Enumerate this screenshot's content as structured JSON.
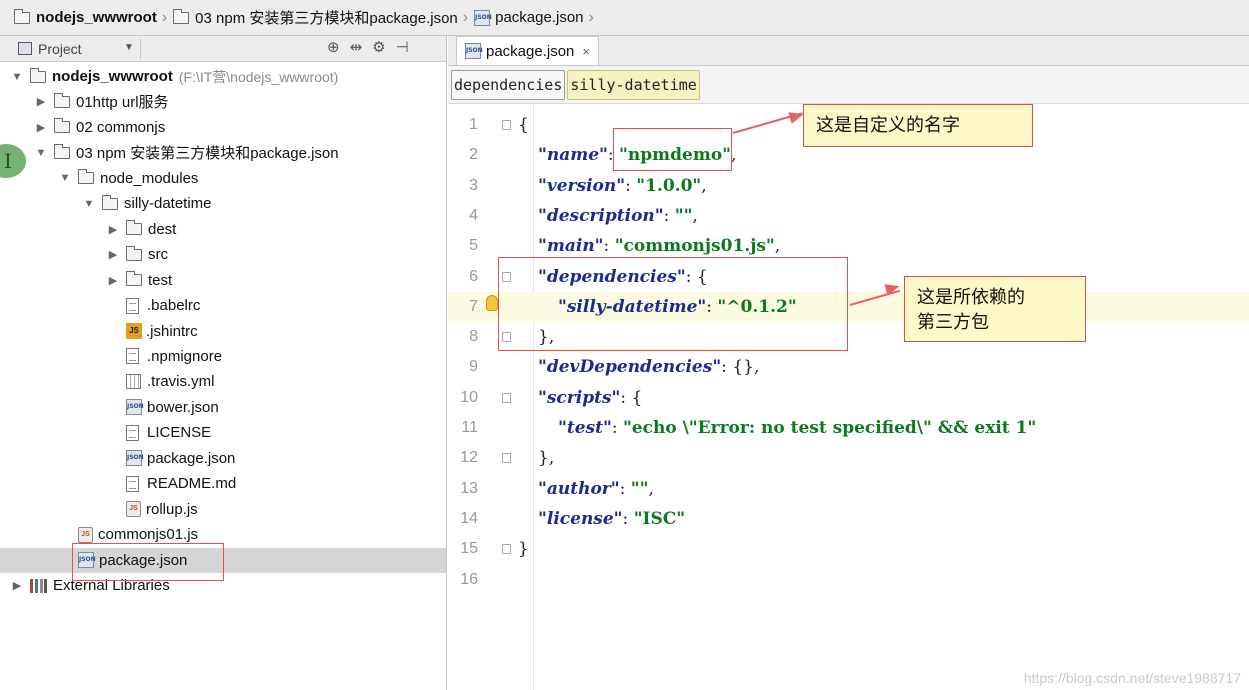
{
  "breadcrumb": [
    {
      "label": "nodejs_wwwroot",
      "icon": "folder-icon",
      "bold": true
    },
    {
      "label": "03 npm 安装第三方模块和package.json",
      "icon": "folder-icon",
      "bold": false
    },
    {
      "label": "package.json",
      "icon": "json-file-icon",
      "bold": false
    }
  ],
  "project_panel": {
    "title": "Project",
    "toolbar_icons": [
      "sync-icon",
      "collapse-icon",
      "gear-icon",
      "hide-panel-icon"
    ],
    "tree": [
      {
        "label": "nodejs_wwwroot",
        "meta": "(F:\\IT营\\nodejs_wwwroot)",
        "type": "folder",
        "level": 0,
        "expanded": true,
        "bold": true
      },
      {
        "label": "01http url服务",
        "type": "folder",
        "level": 1,
        "expanded": false
      },
      {
        "label": "02 commonjs",
        "type": "folder",
        "level": 1,
        "expanded": false
      },
      {
        "label": "03 npm 安装第三方模块和package.json",
        "type": "folder",
        "level": 1,
        "expanded": true
      },
      {
        "label": "node_modules",
        "type": "folder",
        "level": 2,
        "expanded": true
      },
      {
        "label": "silly-datetime",
        "type": "folder",
        "level": 3,
        "expanded": true
      },
      {
        "label": "dest",
        "type": "folder",
        "level": 4,
        "expanded": false
      },
      {
        "label": "src",
        "type": "folder",
        "level": 4,
        "expanded": false
      },
      {
        "label": "test",
        "type": "folder",
        "level": 4,
        "expanded": false
      },
      {
        "label": ".babelrc",
        "type": "file",
        "level": 4
      },
      {
        "label": ".jshintrc",
        "type": "js",
        "level": 4
      },
      {
        "label": ".npmignore",
        "type": "file",
        "level": 4
      },
      {
        "label": ".travis.yml",
        "type": "yml",
        "level": 4
      },
      {
        "label": "bower.json",
        "type": "json",
        "level": 4
      },
      {
        "label": "LICENSE",
        "type": "file",
        "level": 4
      },
      {
        "label": "package.json",
        "type": "json",
        "level": 4
      },
      {
        "label": "README.md",
        "type": "file",
        "level": 4
      },
      {
        "label": "rollup.js",
        "type": "jsfile",
        "level": 4
      },
      {
        "label": "commonjs01.js",
        "type": "jsfile",
        "level": 2
      },
      {
        "label": "package.json",
        "type": "json",
        "level": 2,
        "selected": true
      },
      {
        "label": "External Libraries",
        "type": "lib",
        "level": 0,
        "expanded": false
      }
    ]
  },
  "editor": {
    "tab": {
      "label": "package.json",
      "close": "×"
    },
    "json_path": [
      "dependencies",
      "silly-datetime"
    ],
    "lines": [
      {
        "n": "1",
        "indent": 0,
        "parts": [
          [
            "p",
            "{"
          ]
        ],
        "fold": true
      },
      {
        "n": "2",
        "indent": 1,
        "parts": [
          [
            "k",
            "\"name\""
          ],
          [
            "p",
            ": "
          ],
          [
            "s",
            "\"npmdemo\""
          ],
          [
            "p",
            ","
          ]
        ]
      },
      {
        "n": "3",
        "indent": 1,
        "parts": [
          [
            "k",
            "\"version\""
          ],
          [
            "p",
            ": "
          ],
          [
            "s",
            "\"1.0.0\""
          ],
          [
            "p",
            ","
          ]
        ]
      },
      {
        "n": "4",
        "indent": 1,
        "parts": [
          [
            "k",
            "\"description\""
          ],
          [
            "p",
            ": "
          ],
          [
            "s",
            "\"\""
          ],
          [
            "p",
            ","
          ]
        ]
      },
      {
        "n": "5",
        "indent": 1,
        "parts": [
          [
            "k",
            "\"main\""
          ],
          [
            "p",
            ": "
          ],
          [
            "s",
            "\"commonjs01.js\""
          ],
          [
            "p",
            ","
          ]
        ]
      },
      {
        "n": "6",
        "indent": 1,
        "parts": [
          [
            "k",
            "\"dependencies\""
          ],
          [
            "p",
            ": {"
          ]
        ],
        "fold": true
      },
      {
        "n": "7",
        "indent": 2,
        "parts": [
          [
            "k",
            "\"silly-datetime\""
          ],
          [
            "p",
            ": "
          ],
          [
            "s",
            "\"^0.1.2\""
          ]
        ],
        "highlight": true,
        "bulb": true
      },
      {
        "n": "8",
        "indent": 1,
        "parts": [
          [
            "p",
            "},"
          ]
        ],
        "fold": true
      },
      {
        "n": "9",
        "indent": 1,
        "parts": [
          [
            "k",
            "\"devDependencies\""
          ],
          [
            "p",
            ": {},"
          ]
        ]
      },
      {
        "n": "10",
        "indent": 1,
        "parts": [
          [
            "k",
            "\"scripts\""
          ],
          [
            "p",
            ": {"
          ]
        ],
        "fold": true
      },
      {
        "n": "11",
        "indent": 2,
        "parts": [
          [
            "k",
            "\"test\""
          ],
          [
            "p",
            ": "
          ],
          [
            "s",
            "\"echo \\\"Error: no test specified\\\" && exit 1\""
          ]
        ]
      },
      {
        "n": "12",
        "indent": 1,
        "parts": [
          [
            "p",
            "},"
          ]
        ],
        "fold": true
      },
      {
        "n": "13",
        "indent": 1,
        "parts": [
          [
            "k",
            "\"author\""
          ],
          [
            "p",
            ": "
          ],
          [
            "s",
            "\"\""
          ],
          [
            "p",
            ","
          ]
        ]
      },
      {
        "n": "14",
        "indent": 1,
        "parts": [
          [
            "k",
            "\"license\""
          ],
          [
            "p",
            ": "
          ],
          [
            "s",
            "\"ISC\""
          ]
        ]
      },
      {
        "n": "15",
        "indent": 0,
        "parts": [
          [
            "p",
            "}"
          ]
        ],
        "fold": true
      },
      {
        "n": "16",
        "indent": 0,
        "parts": []
      }
    ]
  },
  "annotations": {
    "callout_name": "这是自定义的名字",
    "callout_deps_line1": "这是所依赖的",
    "callout_deps_line2": "第三方包"
  },
  "watermark": "https://blog.csdn.net/steve1988717",
  "colors": {
    "key": "#1c2a93",
    "string": "#0b7a1f",
    "annotation_red": "#e25050",
    "callout_bg": "#fdf8c8",
    "selection": "#d5d5d5"
  }
}
